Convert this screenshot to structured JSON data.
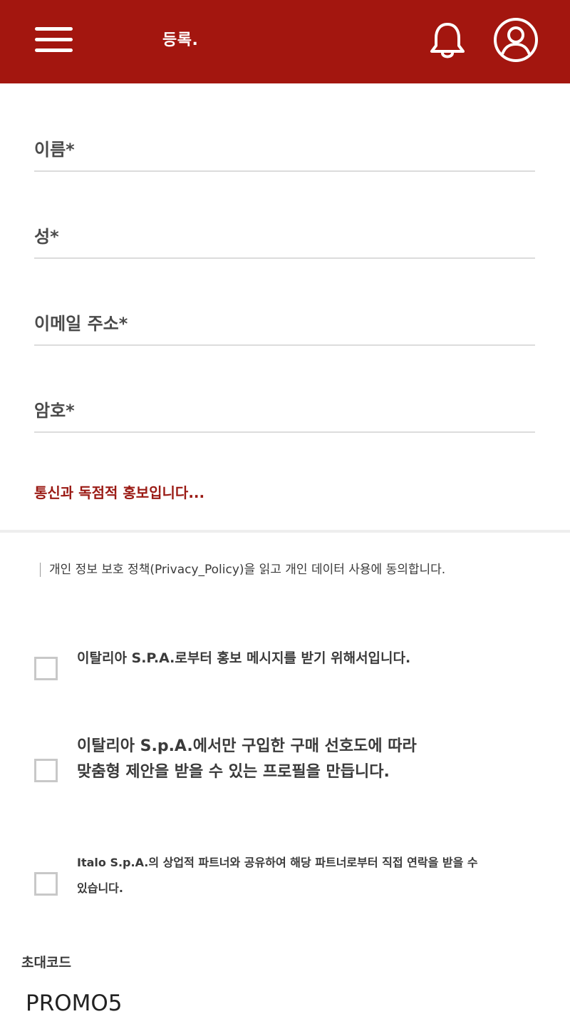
{
  "header": {
    "title": "등록.",
    "menu_icon": "hamburger-menu-icon",
    "bell_icon": "bell-icon",
    "user_icon": "user-profile-icon",
    "background_color": "#a3160f"
  },
  "form": {
    "first_name_label": "이름*",
    "last_name_label": "성*",
    "email_label": "이메일 주소*",
    "password_label": "암호*"
  },
  "promo_text": "통신과 독점적 홍보입니다...",
  "privacy_text": "개인 정보 보호 정책(Privacy_Policy)을 읽고 개인 데이터 사용에 동의합니다.",
  "consents": [
    {
      "text": "이탈리아 S.P.A.로부터 홍보 메시지를 받기 위해서입니다.",
      "checked": false
    },
    {
      "text": "이탈리아 S.p.A.에서만 구입한 구매 선호도에 따라 맞춤형 제안을 받을 수 있는 프로필을 만듭니다.",
      "checked": false
    },
    {
      "text": "Italo S.p.A.의 상업적 파트너와 공유하여 해당 파트너로부터 직접 연락을 받을 수 있습니다.",
      "checked": false
    }
  ],
  "invite": {
    "label": "초대코드",
    "value": "PROMO5"
  },
  "colors": {
    "accent": "#9a1a14",
    "divider": "#dcdcdc"
  }
}
